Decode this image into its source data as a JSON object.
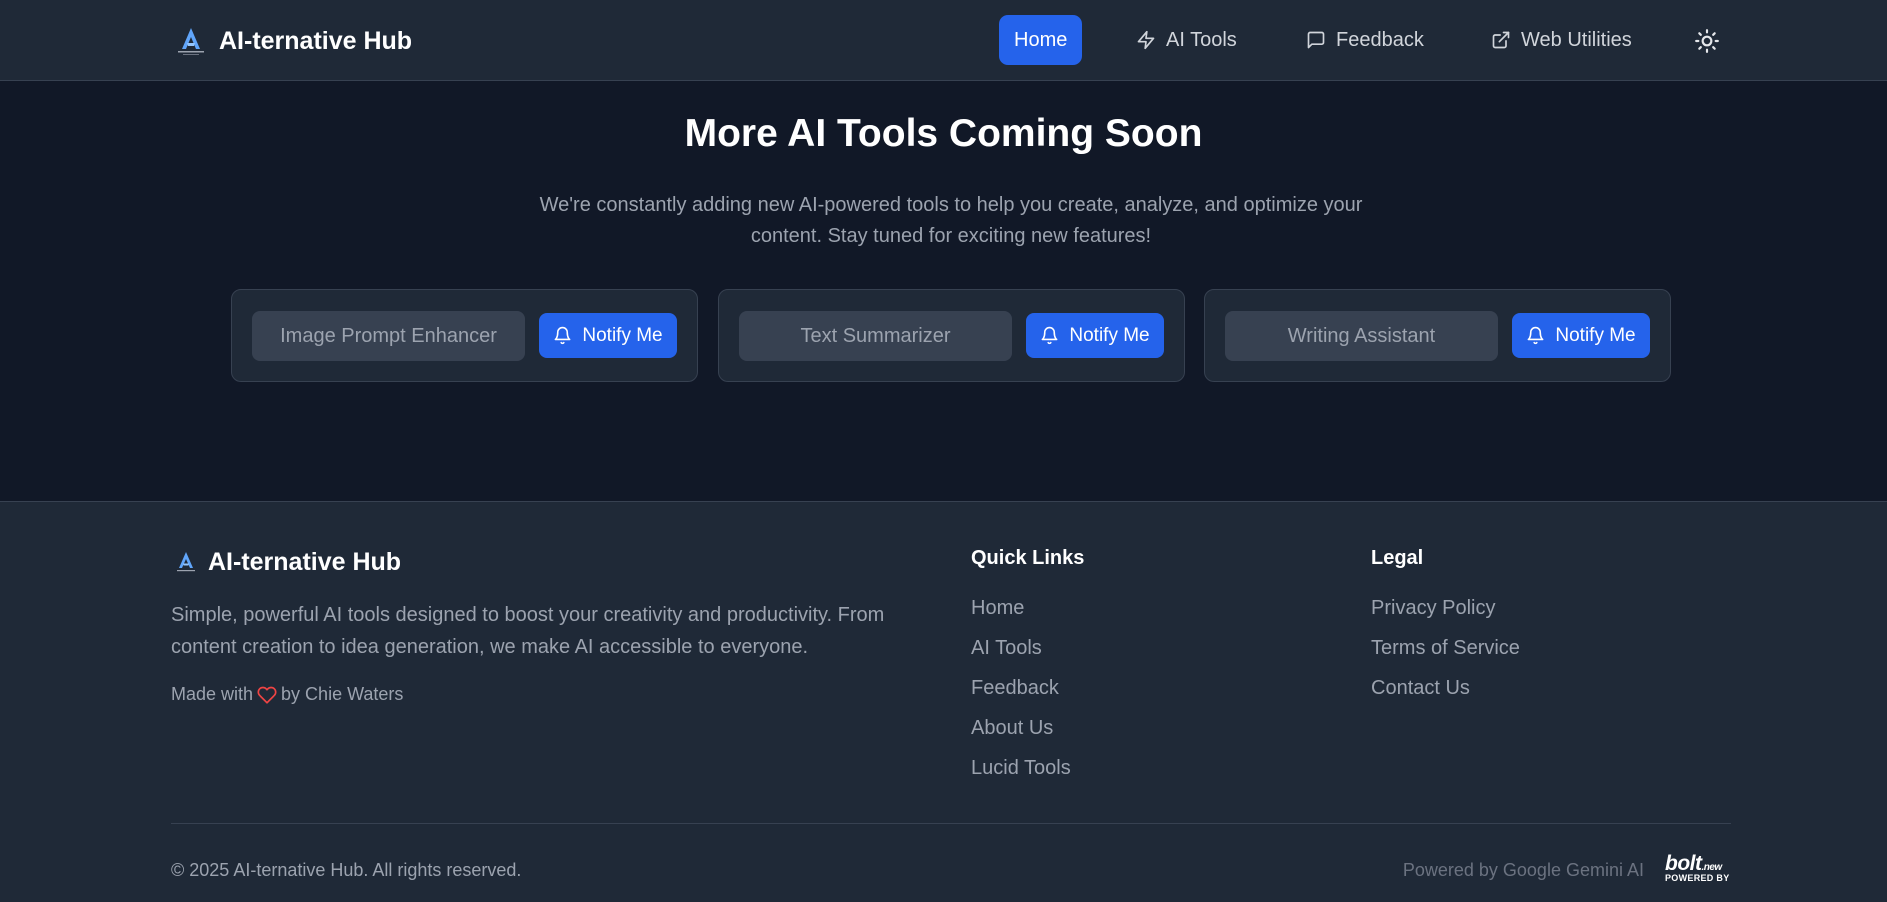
{
  "header": {
    "brand": "AI-ternative Hub",
    "nav": [
      {
        "label": "Home",
        "icon": "none",
        "active": true
      },
      {
        "label": "AI Tools",
        "icon": "bolt-icon",
        "active": false
      },
      {
        "label": "Feedback",
        "icon": "message-square-icon",
        "active": false
      },
      {
        "label": "Web Utilities",
        "icon": "external-link-icon",
        "active": false
      }
    ],
    "theme_toggle_icon": "sun-icon"
  },
  "main": {
    "title": "More AI Tools Coming Soon",
    "description": "We're constantly adding new AI-powered tools to help you create, analyze, and optimize your content. Stay tuned for exciting new features!",
    "cards": [
      {
        "tool": "Image Prompt Enhancer",
        "button": "Notify Me"
      },
      {
        "tool": "Text Summarizer",
        "button": "Notify Me"
      },
      {
        "tool": "Writing Assistant",
        "button": "Notify Me"
      }
    ]
  },
  "footer": {
    "brand": "AI-ternative Hub",
    "description": "Simple, powerful AI tools designed to boost your creativity and productivity. From content creation to idea generation, we make AI accessible to everyone.",
    "made_with_prefix": "Made with",
    "made_with_suffix": "by Chie Waters",
    "quick_links": {
      "title": "Quick Links",
      "links": [
        "Home",
        "AI Tools",
        "Feedback",
        "About Us",
        "Lucid Tools"
      ]
    },
    "legal": {
      "title": "Legal",
      "links": [
        "Privacy Policy",
        "Terms of Service",
        "Contact Us"
      ]
    },
    "copyright": "© 2025 AI-ternative Hub. All rights reserved.",
    "powered_by": "Powered by Google Gemini AI",
    "bolt_logo": {
      "word": "bolt",
      "tld": ".new",
      "caption": "POWERED BY"
    }
  },
  "colors": {
    "accent": "#2563eb",
    "background": "#111827",
    "surface": "#1f2937",
    "heart": "#ef4444"
  }
}
